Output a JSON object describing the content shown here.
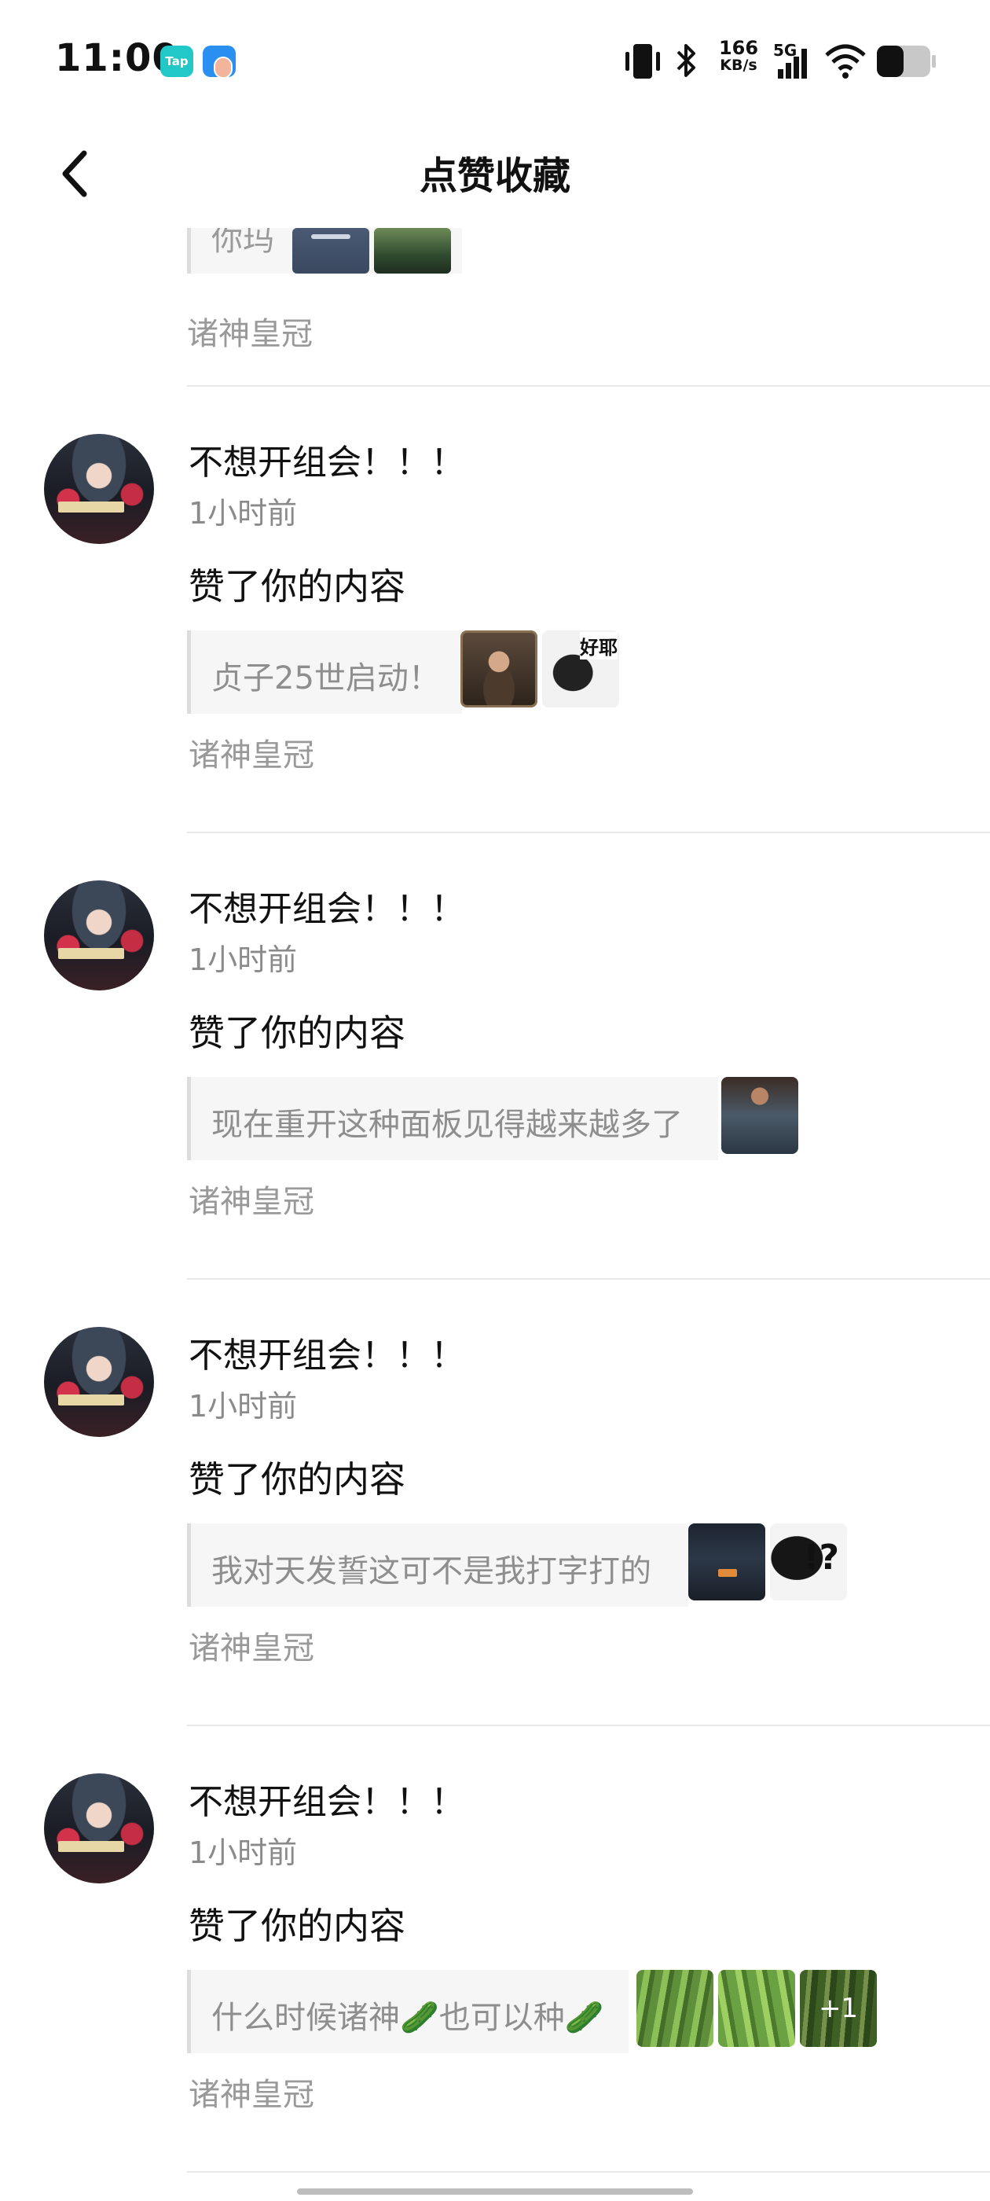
{
  "status_bar": {
    "time": "11:00",
    "app_badge": "Tap",
    "net_speed_value": "166",
    "net_speed_unit": "KB/s",
    "network_type": "5G",
    "icons": [
      "taptap-app-icon",
      "hand-app-icon",
      "vibrate-icon",
      "bluetooth-icon",
      "signal-icon",
      "wifi-icon",
      "battery-icon"
    ]
  },
  "header": {
    "title": "点赞收藏",
    "back_icon": "chevron-left-icon"
  },
  "partial_item": {
    "quote_text": "你玛",
    "game": "诸神皇冠"
  },
  "items": [
    {
      "username": "不想开组会！！！",
      "time": "1小时前",
      "action": "赞了你的内容",
      "quote": "贞子25世启动！",
      "game": "诸神皇冠",
      "thumb_badge": "好耶"
    },
    {
      "username": "不想开组会！！！",
      "time": "1小时前",
      "action": "赞了你的内容",
      "quote": "现在重开这种面板见得越来越多了",
      "game": "诸神皇冠"
    },
    {
      "username": "不想开组会！！！",
      "time": "1小时前",
      "action": "赞了你的内容",
      "quote": "我对天发誓这可不是我打字打的",
      "game": "诸神皇冠",
      "thumb_badge": "!?"
    },
    {
      "username": "不想开组会！！！",
      "time": "1小时前",
      "action": "赞了你的内容",
      "quote": "什么时候诸神🥒也可以种🥒",
      "game": "诸神皇冠",
      "more_count": "+1"
    }
  ]
}
